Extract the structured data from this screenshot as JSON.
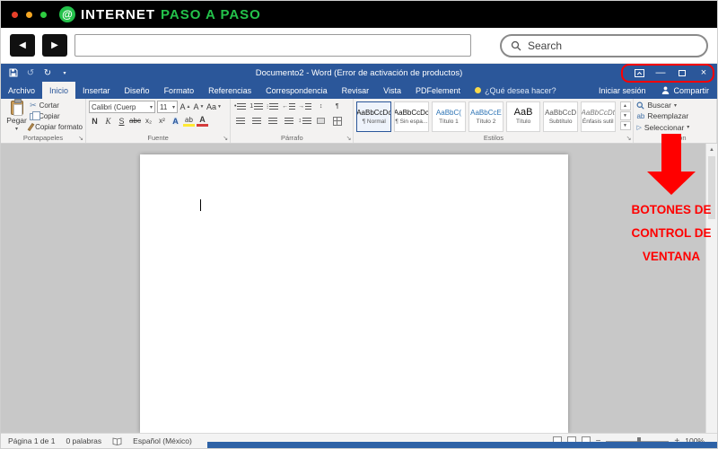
{
  "site": {
    "at": "@",
    "brand_white": "INTERNET",
    "brand_green": "PASO A PASO",
    "search_placeholder": "Search"
  },
  "word": {
    "title": "Documento2 - Word (Error de activación de productos)",
    "tabs": [
      "Archivo",
      "Inicio",
      "Insertar",
      "Diseño",
      "Formato",
      "Referencias",
      "Correspondencia",
      "Revisar",
      "Vista",
      "PDFelement"
    ],
    "tell_me": "¿Qué desea hacer?",
    "sign_in": "Iniciar sesión",
    "share": "Compartir",
    "ribbon": {
      "clipboard": {
        "paste": "Pegar",
        "cut": "Cortar",
        "copy": "Copiar",
        "format_painter": "Copiar formato",
        "group": "Portapapeles"
      },
      "font": {
        "family": "Calibri (Cuerp",
        "size": "11",
        "grow": "A",
        "shrink": "A",
        "change_case": "Aa",
        "bold": "N",
        "italic": "K",
        "underline": "S",
        "strike": "abc",
        "subscript": "x₂",
        "superscript": "x²",
        "color_letter": "A",
        "highlight": "ab",
        "group": "Fuente"
      },
      "paragraph": {
        "group": "Párrafo"
      },
      "styles": {
        "group": "Estilos",
        "items": [
          {
            "sample": "AaBbCcDc",
            "name": "¶ Normal"
          },
          {
            "sample": "AaBbCcDc",
            "name": "¶ Sin espa..."
          },
          {
            "sample": "AaBbC(",
            "name": "Título 1"
          },
          {
            "sample": "AaBbCcE",
            "name": "Título 2"
          },
          {
            "sample": "AaB",
            "name": "Título"
          },
          {
            "sample": "AaBbCcD",
            "name": "Subtítulo"
          },
          {
            "sample": "AaBbCcDt",
            "name": "Énfasis sutil"
          }
        ]
      },
      "editing": {
        "find": "Buscar",
        "replace": "Reemplazar",
        "select": "Seleccionar",
        "group": "Edición"
      }
    },
    "status": {
      "page": "Página 1 de 1",
      "words": "0 palabras",
      "language": "Español (México)",
      "zoom": "100%"
    }
  },
  "annotation": {
    "lines": [
      "BOTONES DE",
      "CONTROL DE",
      "VENTANA"
    ]
  }
}
